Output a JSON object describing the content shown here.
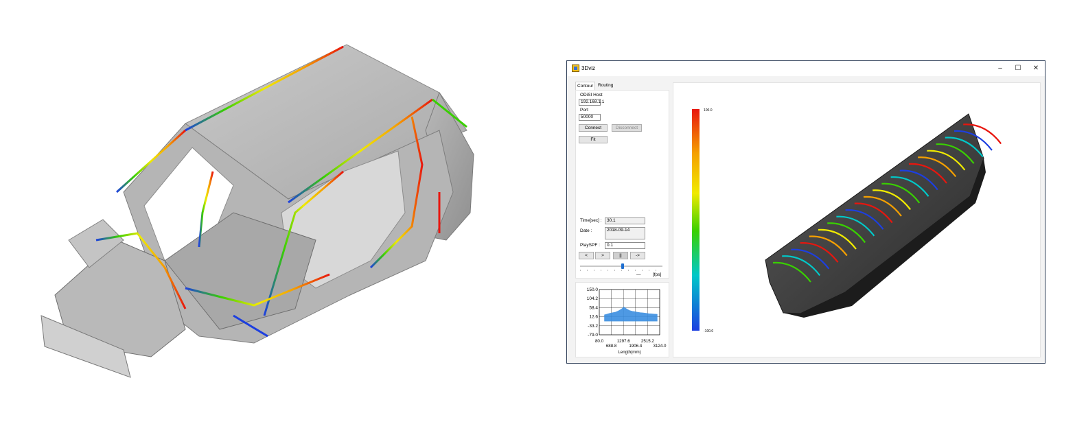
{
  "window": {
    "title": "3Dviz",
    "minimize_glyph": "–",
    "maximize_glyph": "☐",
    "close_glyph": "✕"
  },
  "tabs": [
    {
      "label": "Contour",
      "active": true
    },
    {
      "label": "Routing",
      "active": false
    }
  ],
  "connection": {
    "host_label": "ODiSI Host",
    "host_value": "192.168.1.1",
    "port_label": "Port",
    "port_value": "50000",
    "connect_label": "Connect",
    "disconnect_label": "Disconnect",
    "fit_label": "Fit"
  },
  "playback": {
    "time_label": "Time[sec] :",
    "time_value": "30.1",
    "date_label": "Date :",
    "date_value": "2018-09-14",
    "playspf_label": "PlaySPF :",
    "playspf_value": "0.1",
    "buttons": [
      "<",
      ">",
      "||",
      "->"
    ],
    "slider_position": 0.52,
    "fps_label": "[fps]"
  },
  "colorbar": {
    "max_label": "100.0",
    "min_label": "-100.0",
    "colors": [
      "#e8160e",
      "#f5a000",
      "#f0ea00",
      "#39d000",
      "#00c8c8",
      "#1d3fe0"
    ]
  },
  "chart_data": {
    "type": "area",
    "y_ticks": [
      "150.0",
      "104.2",
      "58.4",
      "12.6",
      "-33.2",
      "-79.0"
    ],
    "x_ticks_row1": [
      "80.0",
      "1297.6",
      "2515.2"
    ],
    "x_ticks_row2": [
      "688.8",
      "1906.4",
      "3124.0"
    ],
    "xlabel": "Length(mm)",
    "ylim": [
      -79.0,
      150.0
    ],
    "xlim": [
      80.0,
      3124.0
    ],
    "series": [
      {
        "color": "#3b8ee0",
        "x": [
          340,
          480,
          620,
          760,
          900,
          1040,
          1180,
          1320,
          1460,
          1600,
          1740,
          1880,
          2020,
          2160,
          2300,
          2440,
          2580,
          2720,
          2860,
          3000
        ],
        "y": [
          22,
          26,
          30,
          33,
          36,
          42,
          50,
          62,
          52,
          44,
          40,
          38,
          35,
          33,
          32,
          30,
          28,
          27,
          26,
          25
        ]
      }
    ]
  }
}
